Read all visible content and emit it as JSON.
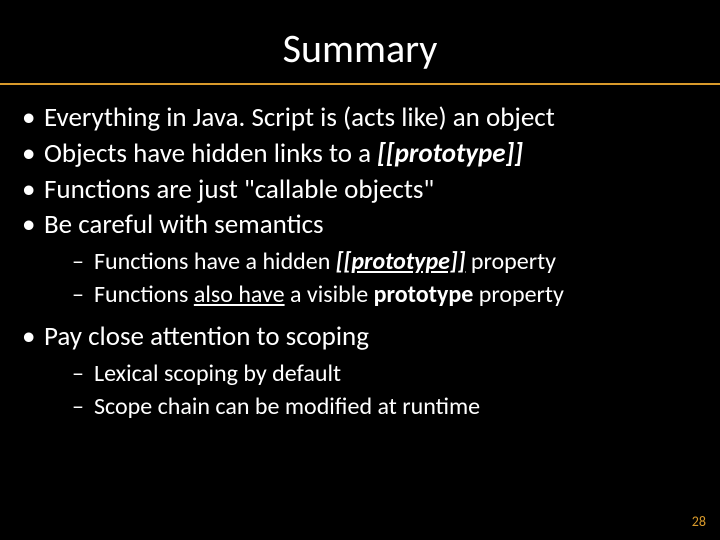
{
  "title": "Summary",
  "bullets": [
    {
      "text": "Everything in Java. Script is (acts like) an object"
    },
    {
      "text": "Objects have hidden links to a ",
      "spans": [
        {
          "text": "Objects have hidden links to a "
        },
        {
          "text": "[[prototype]]",
          "style": "bi"
        }
      ]
    },
    {
      "text": "Functions are just \"callable objects\""
    },
    {
      "text": "Be careful with semantics",
      "sub": [
        {
          "spans": [
            {
              "text": "Functions have a hidden "
            },
            {
              "text": "[[prototype]]",
              "style": "bi u"
            },
            {
              "text": " property"
            }
          ]
        },
        {
          "spans": [
            {
              "text": "Functions "
            },
            {
              "text": "also have",
              "style": "u"
            },
            {
              "text": " a visible "
            },
            {
              "text": "prototype",
              "style": "b"
            },
            {
              "text": " property"
            }
          ]
        }
      ]
    },
    {
      "text": "Pay close attention to scoping",
      "sub": [
        {
          "spans": [
            {
              "text": "Lexical scoping by default"
            }
          ]
        },
        {
          "spans": [
            {
              "text": "Scope chain can be modified at runtime"
            }
          ]
        }
      ]
    }
  ],
  "page_number": "28",
  "colors": {
    "accent": "#d99a2b",
    "bg": "#000000",
    "fg": "#ffffff"
  }
}
